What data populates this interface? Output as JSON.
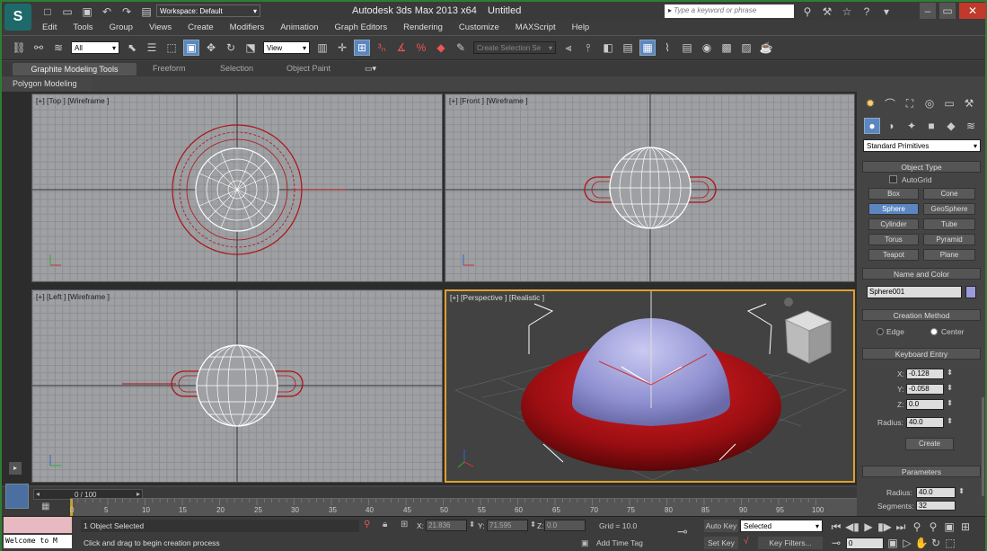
{
  "title": {
    "workspace": "Workspace: Default",
    "app": "Autodesk 3ds Max  2013 x64",
    "doc": "Untitled",
    "search_placeholder": "Type a keyword or phrase"
  },
  "menu": [
    "Edit",
    "Tools",
    "Group",
    "Views",
    "Create",
    "Modifiers",
    "Animation",
    "Graph Editors",
    "Rendering",
    "Customize",
    "MAXScript",
    "Help"
  ],
  "toolbar": {
    "filter": "All",
    "refcoord": "View",
    "selset": "Create Selection Se"
  },
  "ribbon": {
    "tabs": [
      "Graphite Modeling Tools",
      "Freeform",
      "Selection",
      "Object Paint"
    ],
    "panel": "Polygon Modeling"
  },
  "viewports": {
    "top": "[+] [Top ] [Wireframe ]",
    "front": "[+] [Front ] [Wireframe ]",
    "left": "[+] [Left ] [Wireframe ]",
    "persp": "[+] [Perspective ] [Realistic ]"
  },
  "cmd": {
    "category": "Standard Primitives",
    "object_type": "Object Type",
    "autogrid": "AutoGrid",
    "buttons": [
      "Box",
      "Cone",
      "Sphere",
      "GeoSphere",
      "Cylinder",
      "Tube",
      "Torus",
      "Pyramid",
      "Teapot",
      "Plane"
    ],
    "name_color": "Name and Color",
    "name": "Sphere001",
    "creation_method": "Creation Method",
    "edge": "Edge",
    "center": "Center",
    "keyboard_entry": "Keyboard Entry",
    "x_label": "X:",
    "x": "-0.128",
    "y_label": "Y:",
    "y": "-0.058",
    "z_label": "Z:",
    "z": "0.0",
    "radius_label": "Radius:",
    "radius": "40.0",
    "create": "Create",
    "parameters": "Parameters",
    "p_radius_label": "Radius:",
    "p_radius": "40.0",
    "segments_label": "Segments:",
    "segments": "32"
  },
  "timeline": {
    "frame": "0 / 100",
    "ticks": [
      "0",
      "5",
      "10",
      "15",
      "20",
      "25",
      "30",
      "35",
      "40",
      "45",
      "50",
      "55",
      "60",
      "65",
      "70",
      "75",
      "80",
      "85",
      "90",
      "95",
      "100"
    ]
  },
  "status": {
    "maxscript": "Welcome to M",
    "selected": "1 Object Selected",
    "prompt": "Click and drag to begin creation process",
    "x_label": "X:",
    "x": "21.836",
    "y_label": "Y:",
    "y": "71.595",
    "z_label": "Z:",
    "z": "0.0",
    "grid": "Grid = 10.0",
    "add_time_tag": "Add Time Tag",
    "auto_key": "Auto Key",
    "set_key": "Set Key",
    "key_mode": "Selected",
    "key_filters": "Key Filters...",
    "frame_field": "0"
  },
  "colors": {
    "accent": "#5b86c2",
    "torus": "#b01015",
    "sphere": "#9a9bd8",
    "persp_border": "#e0a030"
  }
}
